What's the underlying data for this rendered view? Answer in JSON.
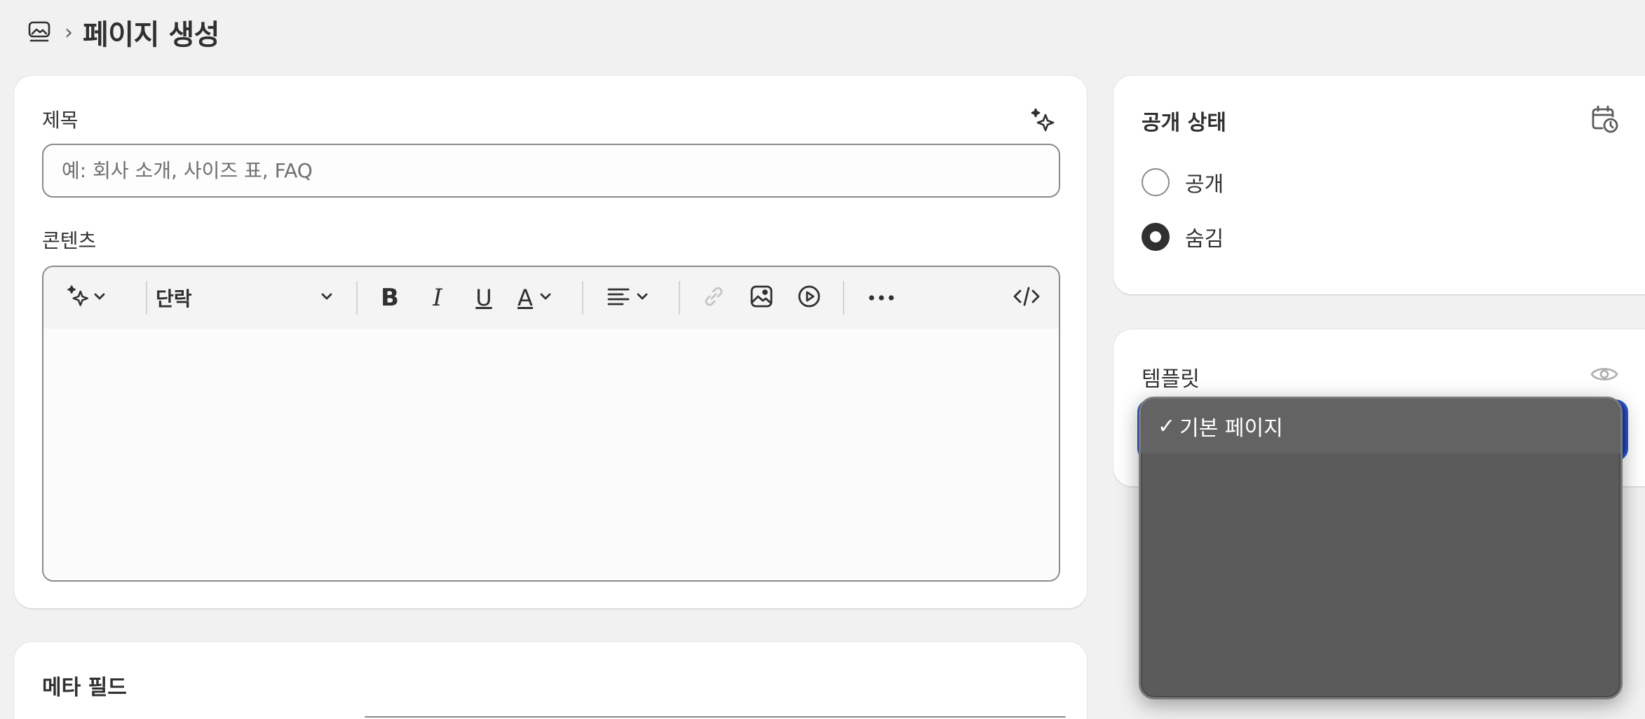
{
  "header": {
    "section_icon": "pages-icon",
    "separator": "›",
    "title": "페이지 생성"
  },
  "main": {
    "title_label": "제목",
    "title_placeholder": "예: 회사 소개, 사이즈 표, FAQ",
    "title_value": "",
    "content_label": "콘텐츠",
    "toolbar": {
      "ai_icon": "sparkle-icon",
      "paragraph_select": "단락",
      "bold": "B",
      "italic": "I",
      "underline": "U",
      "text_color": "A",
      "align_icon": "align-left-icon",
      "link_icon": "link-icon",
      "image_icon": "image-icon",
      "video_icon": "play-circle-icon",
      "more_icon": "more-horizontal-icon",
      "code_icon": "code-icon"
    }
  },
  "meta": {
    "title": "메타 필드"
  },
  "visibility": {
    "title": "공개 상태",
    "schedule_icon": "calendar-clock-icon",
    "options": [
      {
        "label": "공개",
        "checked": false
      },
      {
        "label": "숨김",
        "checked": true
      }
    ]
  },
  "template": {
    "title": "템플릿",
    "preview_icon": "eye-icon",
    "dropdown": {
      "selected": "기본 페이지",
      "check_mark": "✓"
    }
  },
  "colors": {
    "background": "#f1f1f1",
    "card": "#ffffff",
    "text": "#303030",
    "focus_blue": "#2a54c4",
    "dropdown_bg": "#5b5b5b"
  }
}
